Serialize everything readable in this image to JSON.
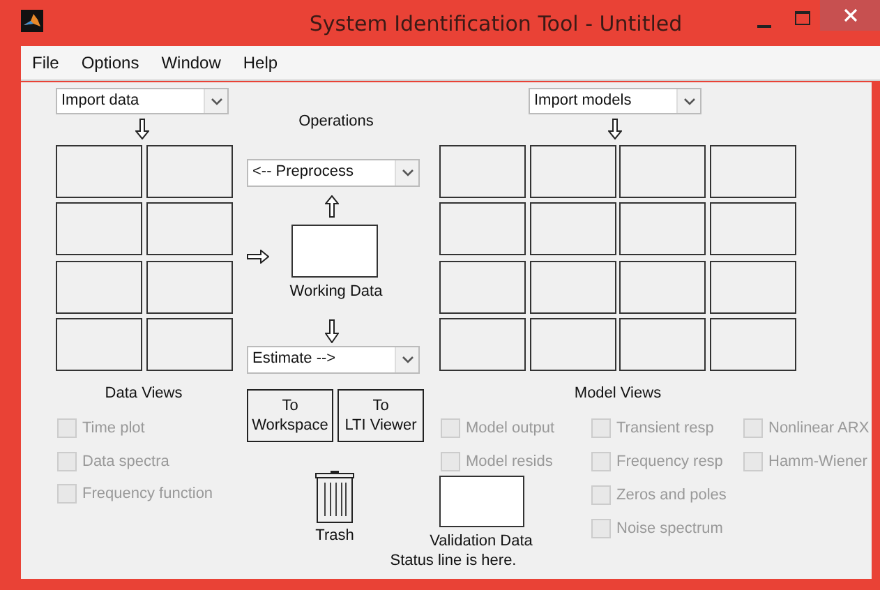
{
  "window": {
    "title": "System Identification Tool - Untitled"
  },
  "menu": [
    "File",
    "Options",
    "Window",
    "Help"
  ],
  "data_import": {
    "value": "Import data"
  },
  "model_import": {
    "value": "Import models"
  },
  "operations": {
    "label": "Operations",
    "preprocess": "<-- Preprocess",
    "working_data": "Working Data",
    "estimate": "Estimate -->"
  },
  "data_views": {
    "label": "Data Views",
    "options": [
      {
        "label": "Time plot",
        "checked": false,
        "disabled": true
      },
      {
        "label": "Data spectra",
        "checked": false,
        "disabled": true
      },
      {
        "label": "Frequency function",
        "checked": false,
        "disabled": true
      }
    ]
  },
  "buttons": [
    {
      "line1": "To",
      "line2": "Workspace"
    },
    {
      "line1": "To",
      "line2": "LTI Viewer"
    }
  ],
  "trash": {
    "label": "Trash"
  },
  "validation": {
    "label": "Validation Data"
  },
  "status_line": "Status line is here.",
  "model_views": {
    "label": "Model Views",
    "columns": [
      [
        {
          "label": "Model output",
          "checked": false,
          "disabled": true
        },
        {
          "label": "Model resids",
          "checked": false,
          "disabled": true
        }
      ],
      [
        {
          "label": "Transient resp",
          "checked": false,
          "disabled": true
        },
        {
          "label": "Frequency resp",
          "checked": false,
          "disabled": true
        },
        {
          "label": "Zeros and poles",
          "checked": false,
          "disabled": true
        },
        {
          "label": "Noise spectrum",
          "checked": false,
          "disabled": true
        }
      ],
      [
        {
          "label": "Nonlinear ARX",
          "checked": false,
          "disabled": true
        },
        {
          "label": "Hamm-Wiener",
          "checked": false,
          "disabled": true
        }
      ]
    ]
  }
}
